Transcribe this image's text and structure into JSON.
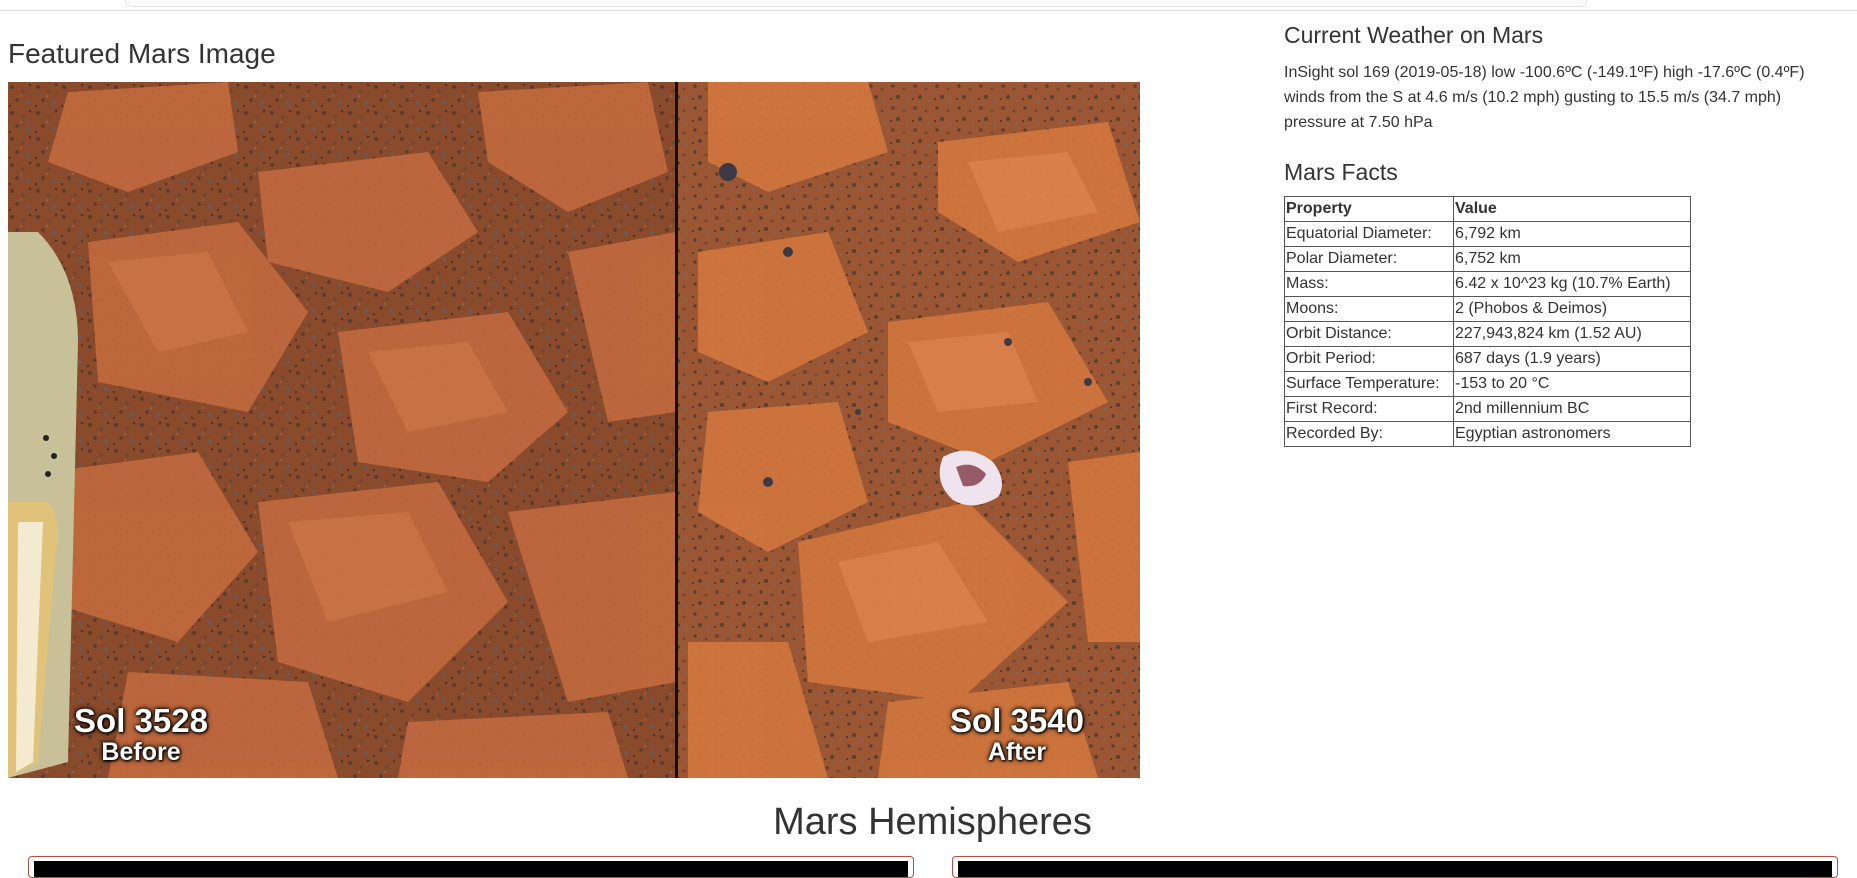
{
  "featured": {
    "title": "Featured Mars Image",
    "before_sol": "Sol 3528",
    "before_label": "Before",
    "after_sol": "Sol 3540",
    "after_label": "After"
  },
  "weather": {
    "title": "Current Weather on Mars",
    "text": "InSight sol 169 (2019-05-18) low -100.6ºC (-149.1ºF) high -17.6ºC (0.4ºF) winds from the S at 4.6 m/s (10.2 mph) gusting to 15.5 m/s (34.7 mph) pressure at 7.50 hPa"
  },
  "facts": {
    "title": "Mars Facts",
    "headers": [
      "Property",
      "Value"
    ],
    "rows": [
      {
        "property": "Equatorial Diameter:",
        "value": "6,792 km"
      },
      {
        "property": "Polar Diameter:",
        "value": "6,752 km"
      },
      {
        "property": "Mass:",
        "value": "6.42 x 10^23 kg (10.7% Earth)"
      },
      {
        "property": "Moons:",
        "value": "2 (Phobos & Deimos)"
      },
      {
        "property": "Orbit Distance:",
        "value": "227,943,824 km (1.52 AU)"
      },
      {
        "property": "Orbit Period:",
        "value": "687 days (1.9 years)"
      },
      {
        "property": "Surface Temperature:",
        "value": "-153 to 20 °C"
      },
      {
        "property": "First Record:",
        "value": "2nd millennium BC"
      },
      {
        "property": "Recorded By:",
        "value": "Egyptian astronomers"
      }
    ]
  },
  "hemispheres": {
    "title": "Mars Hemispheres"
  },
  "colors": {
    "card_border": "#b94a48",
    "mars_soil": "#a0522d"
  }
}
